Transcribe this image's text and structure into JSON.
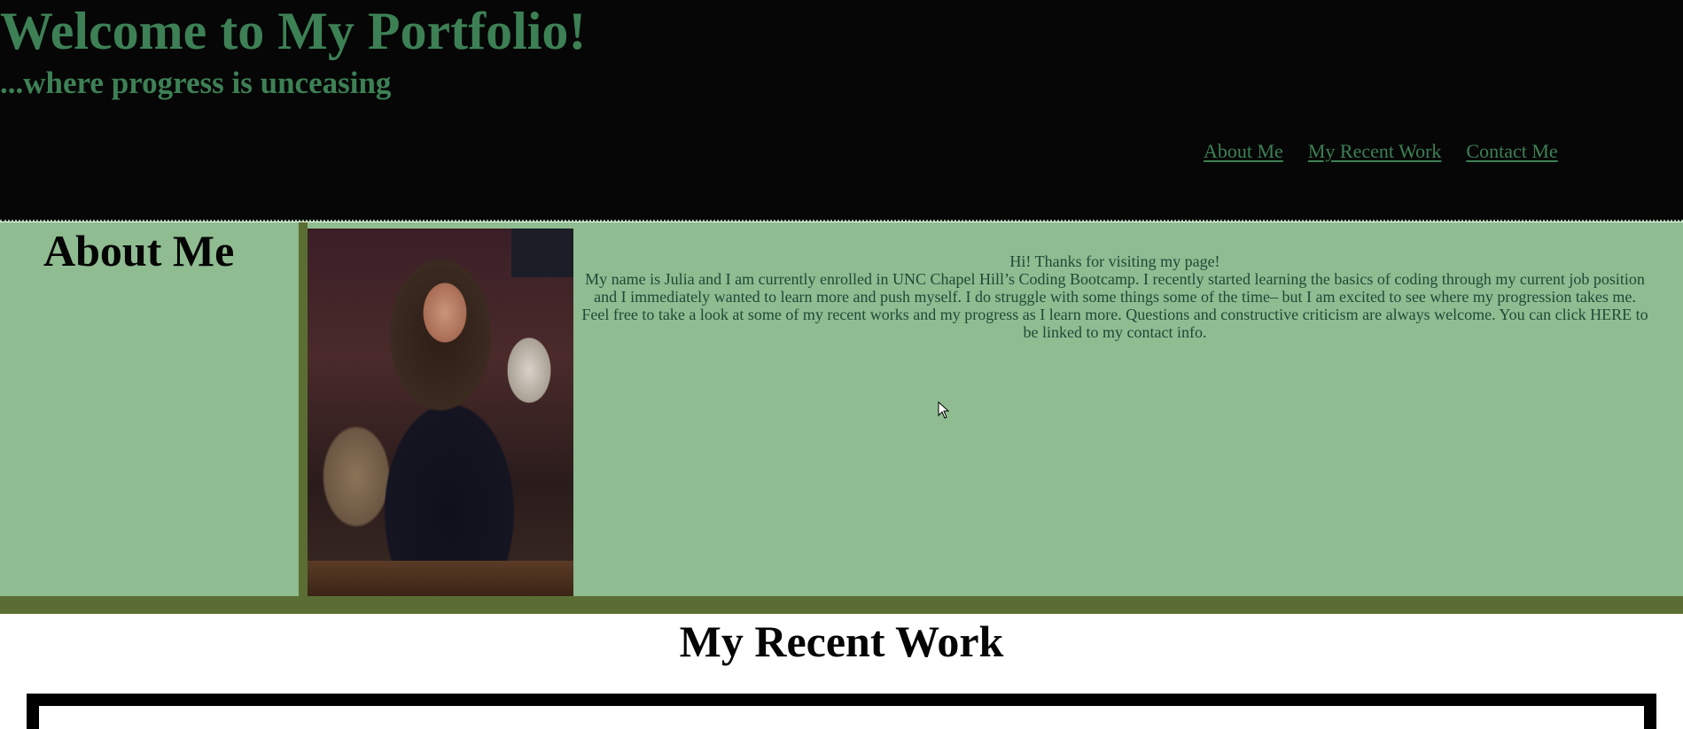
{
  "header": {
    "title": "Welcome to My Portfolio!",
    "tagline": "...where progress is unceasing",
    "nav": [
      "About Me",
      "My Recent Work",
      "Contact Me"
    ]
  },
  "about": {
    "heading": "About Me",
    "photo_alt": "Portrait photo of Julia",
    "paragraphs": [
      "Hi! Thanks for visiting my page!",
      "My name is Julia and I am currently enrolled in UNC Chapel Hill’s Coding Bootcamp. I recently started learning the basics of coding through my current job position and I immediately wanted to learn more and push myself. I do struggle with some things some of the time– but I am excited to see where my progression takes me.",
      "Feel free to take a look at some of my recent works and my progress as I learn more. Questions and constructive criticism are always welcome. You can click HERE to be linked to my contact info."
    ]
  },
  "work": {
    "heading": "My Recent Work"
  },
  "colors": {
    "header_bg": "#060606",
    "accent_green": "#3d8055",
    "about_bg": "#8fbc91",
    "olive": "#5a6e33"
  },
  "icons": [
    "mouse-pointer-icon"
  ]
}
